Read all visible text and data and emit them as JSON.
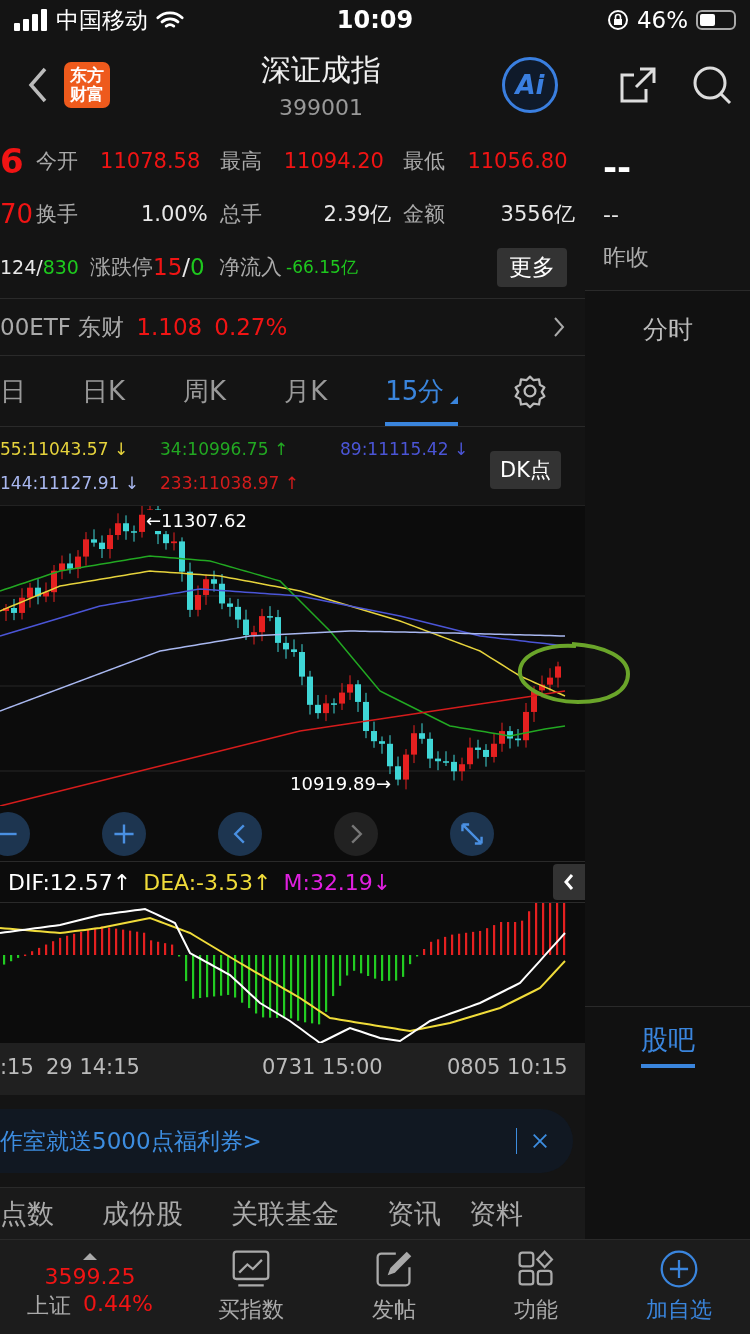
{
  "status_bar": {
    "carrier": "中国移动",
    "time": "10:09",
    "battery": "46%"
  },
  "header": {
    "logo_lines": [
      "东方",
      "财富"
    ],
    "title": "深证成指",
    "code": "399001",
    "ai_label": "Ai"
  },
  "quote": {
    "price_fragment": "6",
    "change_fragment": "70",
    "advance": "124",
    "advance_sep": "/",
    "decline": "830",
    "stats": [
      {
        "label": "今开",
        "value": "11078.58",
        "color": "#f01414"
      },
      {
        "label": "最高",
        "value": "11094.20",
        "color": "#f01414"
      },
      {
        "label": "最低",
        "value": "11056.80",
        "color": "#f01414"
      },
      {
        "label": "换手",
        "value": "1.00%",
        "color": "#e8e8e8"
      },
      {
        "label": "总手",
        "value": "2.39亿",
        "color": "#e8e8e8"
      },
      {
        "label": "金额",
        "value": "3556亿",
        "color": "#e8e8e8"
      }
    ],
    "limit_label": "涨跌停",
    "limit_up": "15",
    "limit_sep": "/",
    "limit_down": "0",
    "netflow_label": "净流入",
    "netflow": "-66.15亿",
    "more_button": "更多"
  },
  "side_panel": {
    "price": "--",
    "change": "--",
    "prev_close_label": "昨收",
    "intraday_tab": "分时",
    "forum_tab": "股吧"
  },
  "etf": {
    "name": "00ETF 东财",
    "price": "1.108",
    "change": "0.27%"
  },
  "period_tabs": [
    {
      "label": "日",
      "selected": false
    },
    {
      "label": "日K",
      "selected": false
    },
    {
      "label": "周K",
      "selected": false
    },
    {
      "label": "月K",
      "selected": false
    },
    {
      "label": "15分",
      "selected": true
    }
  ],
  "ma_legend": [
    {
      "label": "55:11043.57",
      "arrow": "↓",
      "color": "#e6d33c"
    },
    {
      "label": "34:10996.75",
      "arrow": "↑",
      "color": "#22a822"
    },
    {
      "label": "89:11115.42",
      "arrow": "↓",
      "color": "#4b55d6"
    },
    {
      "label": "144:11127.91",
      "arrow": "↓",
      "color": "#a9b8f0"
    },
    {
      "label": "233:11038.97",
      "arrow": "↑",
      "color": "#d41c1c"
    }
  ],
  "dk_button": "DK点",
  "chart_labels": {
    "high": "←11307.62",
    "low": "10919.89→"
  },
  "macd_legend": [
    {
      "label": "DIF:12.57",
      "arrow": "↑",
      "color": "#ffffff"
    },
    {
      "label": "DEA:-3.53",
      "arrow": "↑",
      "color": "#f0dc3a"
    },
    {
      "label": "M:32.19",
      "arrow": "↓",
      "color": "#e020e0"
    }
  ],
  "time_axis": [
    ":15",
    "29 14:15",
    "0731 15:00",
    "0805 10:15"
  ],
  "banner": {
    "text": "作室就送5000点福利券>"
  },
  "section_tabs": [
    "点数",
    "成份股",
    "关联基金",
    "资讯",
    "资料"
  ],
  "bottom_bar": {
    "index": {
      "value": "3599.25",
      "name": "上证",
      "change": "0.44%",
      "color": "#f01414"
    },
    "items": [
      {
        "label": "买指数",
        "kind": "chart",
        "accent": false
      },
      {
        "label": "发帖",
        "kind": "edit",
        "accent": false
      },
      {
        "label": "功能",
        "kind": "grid",
        "accent": false
      },
      {
        "label": "加自选",
        "kind": "add",
        "accent": true
      }
    ]
  }
}
